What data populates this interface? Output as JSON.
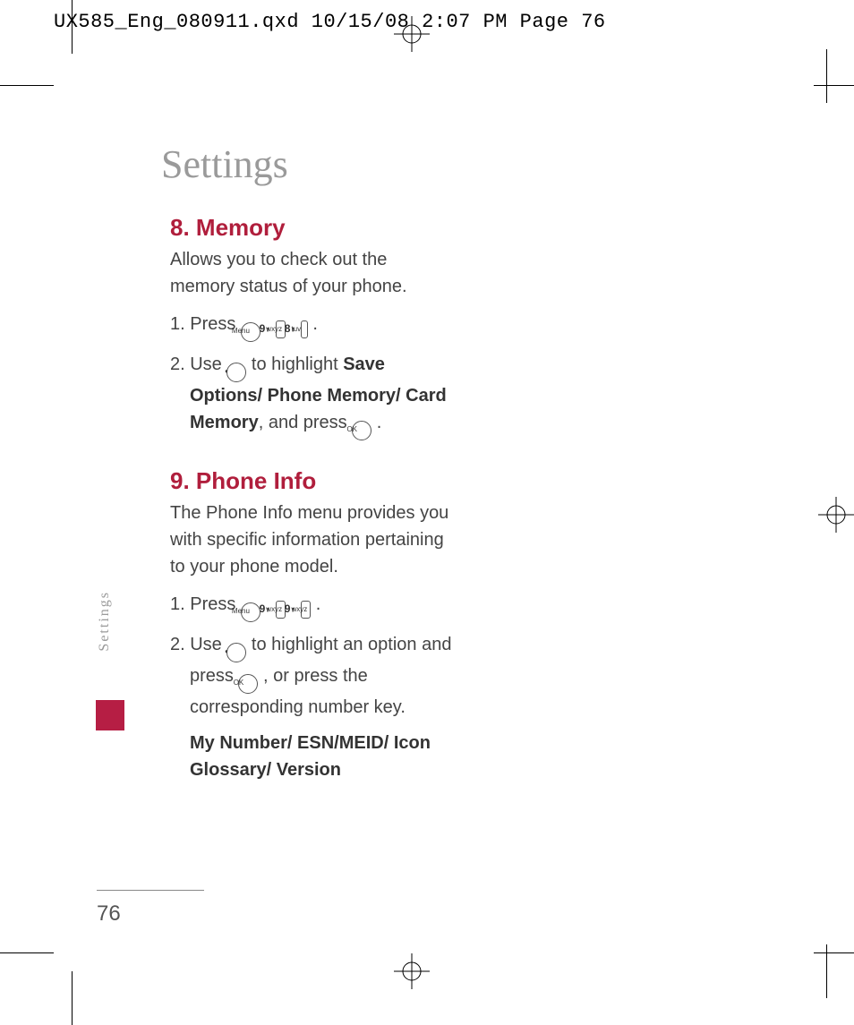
{
  "slug": "UX585_Eng_080911.qxd  10/15/08  2:07 PM  Page 76",
  "title": "Settings",
  "sidetab": "Settings",
  "pagenum": "76",
  "sec8": {
    "heading": "8. Memory",
    "intro": "Allows you to check out the memory status of your phone.",
    "step1_lead": "1. Press ",
    "step2_lead": "2. Use ",
    "step2_mid": " to highlight ",
    "step2_bold": "Save Options/ Phone Memory/ Card Memory",
    "step2_tail": ", and press "
  },
  "sec9": {
    "heading": "9. Phone Info",
    "intro": "The Phone Info menu provides you with specific information pertaining to your phone model.",
    "step1_lead": "1. Press ",
    "step2_lead": "2. Use ",
    "step2_mid": " to highlight an option and press ",
    "step2_tail": ", or press the corresponding number key.",
    "options": "My Number/ ESN/MEID/ Icon Glossary/ Version"
  },
  "keys": {
    "menu": "Menu",
    "ok": "OK",
    "nav": "◐",
    "nine_digit": "9",
    "nine_letters": "wxyz",
    "eight_digit": "8",
    "eight_letters": "tuv"
  }
}
